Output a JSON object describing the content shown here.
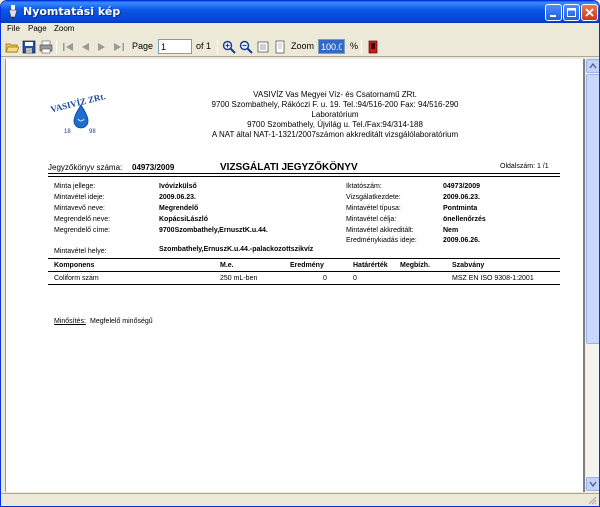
{
  "window": {
    "title": "Nyomtatási kép"
  },
  "menu": {
    "items": [
      "File",
      "Page",
      "Zoom"
    ]
  },
  "toolbar": {
    "page_label": "Page",
    "page_value": "1",
    "of_label": "of 1",
    "zoom_label": "Zoom",
    "zoom_value": "100.0",
    "percent_label": "%"
  },
  "report": {
    "logo_text": "VASIVÍZ ZRt.",
    "logo_years": [
      "18",
      "98"
    ],
    "header_lines": [
      "VASIVÍZ Vas Megyei Víz- és Csatornamű ZRt.",
      "9700 Szombathely, Rákóczi F. u. 19. Tel.:94/516-200 Fax: 94/516-290",
      "Laboratórium",
      "9700 Szombathely, Újvilág u. Tel./Fax:94/314-188",
      "A NAT által NAT-1-1321/2007számon akkreditált vizsgálólaboratórium"
    ],
    "protocol_label": "Jegyzőkönyv száma:",
    "protocol_number": "04973/2009",
    "doc_title": "VIZSGÁLATI JEGYZŐKÖNYV",
    "page_number": "Oldalszám: 1 /1",
    "left_fields": [
      {
        "label": "Minta jellege:",
        "value": "Ivóvízkülső"
      },
      {
        "label": "Mintavétel ideje:",
        "value": "2009.06.23."
      },
      {
        "label": "Mintavevő neve:",
        "value": "Megrendelő"
      },
      {
        "label": "Megrendelő neve:",
        "value": "KopácsiLászló"
      },
      {
        "label": "Megrendelő címe:",
        "value": "9700Szombathely,ErnusztK.u.44."
      }
    ],
    "right_fields": [
      {
        "label": "Iktatószám:",
        "value": "04973/2009"
      },
      {
        "label": "Vizsgálatkezdete:",
        "value": "2009.06.23."
      },
      {
        "label": "Mintavétel típusa:",
        "value": "Pontminta"
      },
      {
        "label": "Mintavétel célja:",
        "value": "önellenőrzés"
      },
      {
        "label": "Mintavétel akkreditált:",
        "value": "Nem"
      },
      {
        "label": "Eredménykiadás ideje:",
        "value": "2009.06.26."
      }
    ],
    "sampling_place_label": "Mintavétel helye:",
    "sampling_place_value": "Szombathely,ErnuszK.u.44.-palackozottszikvíz",
    "table": {
      "headers": [
        "Komponens",
        "M.e.",
        "Eredmény",
        "Határérték",
        "Megbízh.",
        "Szabvány"
      ],
      "rows": [
        [
          "Coliform szám",
          "250 mL-ben",
          "0",
          "0",
          "",
          "MSZ EN ISO 9308-1:2001"
        ]
      ]
    },
    "qualification_label": "Minősítés:",
    "qualification_value": "Megfelelő minőségű"
  }
}
